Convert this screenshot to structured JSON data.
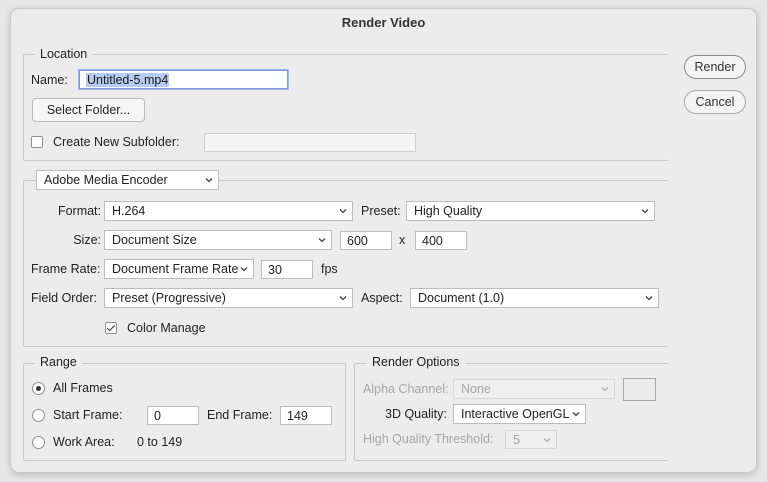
{
  "dialog": {
    "title": "Render Video",
    "render_label": "Render",
    "cancel_label": "Cancel"
  },
  "location": {
    "legend": "Location",
    "name_label": "Name:",
    "name_value": "Untitled-5.mp4",
    "select_folder_label": "Select Folder...",
    "subfolder_label": "Create New Subfolder:",
    "subfolder_checked": false,
    "subfolder_value": ""
  },
  "encoder": {
    "selected": "Adobe Media Encoder",
    "format_label": "Format:",
    "format_value": "H.264",
    "preset_label": "Preset:",
    "preset_value": "High Quality",
    "size_label": "Size:",
    "size_value": "Document Size",
    "width_value": "600",
    "size_separator": "x",
    "height_value": "400",
    "frame_rate_label": "Frame Rate:",
    "frame_rate_value": "Document Frame Rate",
    "fps_value": "30",
    "fps_unit": "fps",
    "field_order_label": "Field Order:",
    "field_order_value": "Preset (Progressive)",
    "aspect_label": "Aspect:",
    "aspect_value": "Document (1.0)",
    "color_manage_label": "Color Manage",
    "color_manage_checked": true
  },
  "range": {
    "legend": "Range",
    "selected": "all_frames",
    "all_frames_label": "All Frames",
    "start_frame_label": "Start Frame:",
    "start_frame_value": "0",
    "end_frame_label": "End Frame:",
    "end_frame_value": "149",
    "work_area_label": "Work Area:",
    "work_area_value": "0 to 149"
  },
  "render_options": {
    "legend": "Render Options",
    "alpha_label": "Alpha Channel:",
    "alpha_value": "None",
    "quality_label": "3D Quality:",
    "quality_value": "Interactive OpenGL",
    "threshold_label": "High Quality Threshold:",
    "threshold_value": "5"
  },
  "icons": {
    "dropdown": "chevron-down-icon",
    "checkbox_checked": "checkmark-icon",
    "radio_selected": "radio-dot-icon"
  },
  "colors": {
    "selection_highlight": "#b6cdf1",
    "focus_ring": "#9cb6e6",
    "dialog_background": "#ececec"
  }
}
